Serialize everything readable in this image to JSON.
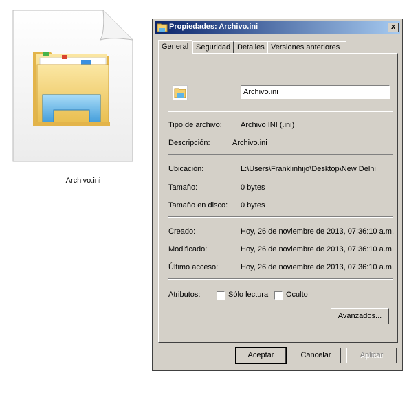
{
  "desktop": {
    "file_label": "Archivo.ini"
  },
  "dialog": {
    "title": "Propiedades: Archivo.ini",
    "close_label": "x",
    "tabs": [
      {
        "label": "General",
        "active": true
      },
      {
        "label": "Seguridad",
        "active": false
      },
      {
        "label": "Detalles",
        "active": false
      },
      {
        "label": "Versiones anteriores",
        "active": false
      }
    ],
    "general": {
      "file_name": "Archivo.ini",
      "type_label": "Tipo de archivo:",
      "type_value": "Archivo INI (.ini)",
      "description_label": "Descripción:",
      "description_value": "Archivo.ini",
      "location_label": "Ubicación:",
      "location_value": "L:\\Users\\Franklinhijo\\Desktop\\New Delhi",
      "size_label": "Tamaño:",
      "size_value": "0 bytes",
      "disk_size_label": "Tamaño en disco:",
      "disk_size_value": "0 bytes",
      "created_label": "Creado:",
      "created_value": "Hoy, 26 de noviembre de 2013, 07:36:10 a.m.",
      "modified_label": "Modificado:",
      "modified_value": "Hoy, 26 de noviembre de 2013, 07:36:10 a.m.",
      "accessed_label": "Último acceso:",
      "accessed_value": "Hoy, 26 de noviembre de 2013, 07:36:10 a.m.",
      "attributes_label": "Atributos:",
      "readonly_label": "Sólo lectura",
      "readonly_checked": false,
      "hidden_label": "Oculto",
      "hidden_checked": false,
      "advanced_button": "Avanzados..."
    },
    "buttons": {
      "accept": "Aceptar",
      "cancel": "Cancelar",
      "apply": "Aplicar"
    }
  },
  "colors": {
    "dialog_bg": "#d4d0c8",
    "title_start": "#0a246a",
    "title_end": "#a6caf0",
    "folder_yellow": "#f4d47a",
    "folder_blue": "#5fb4e6"
  },
  "icons": {
    "desktop_file": "ini-file-explorer-icon",
    "title": "folder-icon",
    "general_file": "folder-small-icon"
  }
}
